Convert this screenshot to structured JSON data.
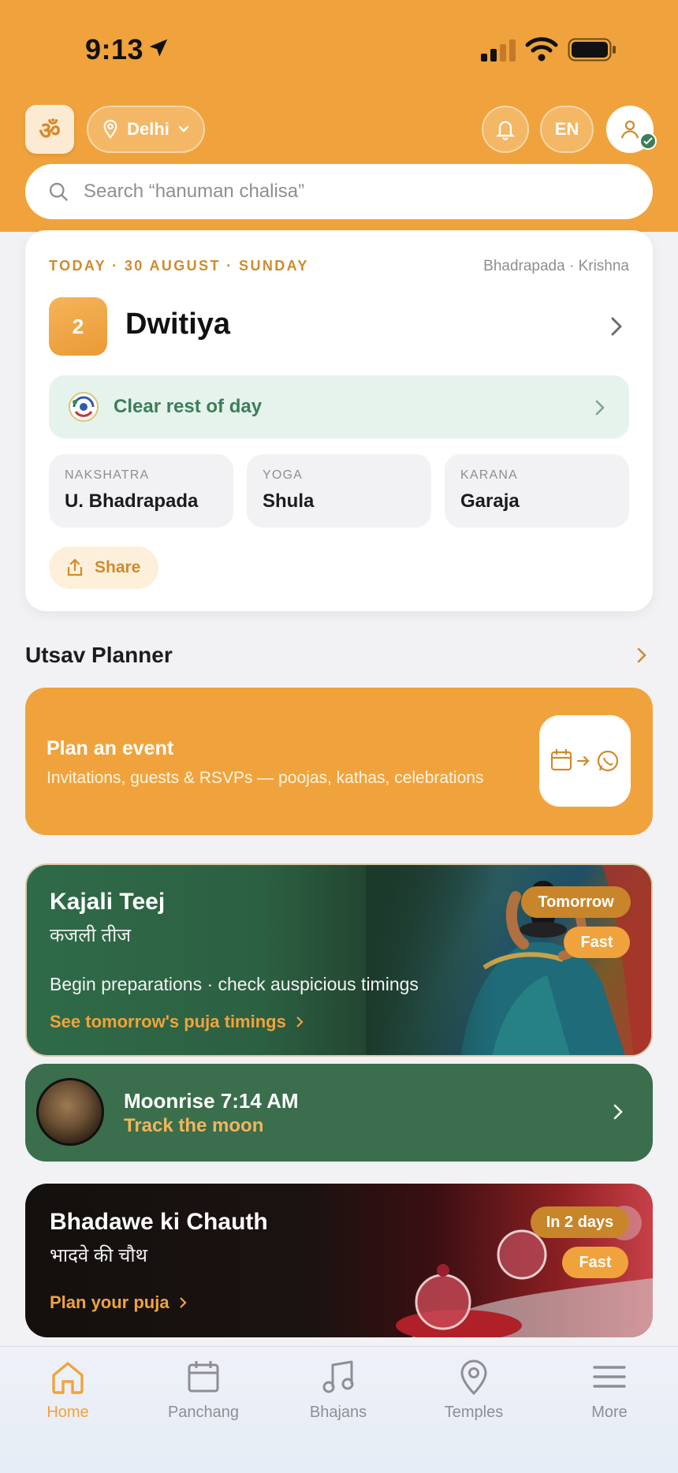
{
  "status_bar": {
    "time": "9:13"
  },
  "header": {
    "logo": "ॐ",
    "location": "Delhi",
    "language": "EN",
    "search_placeholder": "Search “hanuman chalisa”"
  },
  "today": {
    "date_line": "TODAY · 30 AUGUST · SUNDAY",
    "month_paksha": "Bhadrapada · Krishna",
    "tithi_number": "2",
    "tithi_name": "Dwitiya",
    "status": "Clear rest of day",
    "details": [
      {
        "label": "NAKSHATRA",
        "value": "U. Bhadrapada"
      },
      {
        "label": "YOGA",
        "value": "Shula"
      },
      {
        "label": "KARANA",
        "value": "Garaja"
      }
    ],
    "share_label": "Share"
  },
  "utsav": {
    "title": "Utsav Planner",
    "plan_title": "Plan an event",
    "plan_subtitle": "Invitations, guests & RSVPs — poojas, kathas, celebrations"
  },
  "festivals": [
    {
      "name": "Kajali Teej",
      "hindi": "कजली तीज",
      "desc": "Begin preparations · check auspicious timings",
      "link": "See tomorrow's puja timings",
      "when": "Tomorrow",
      "tag": "Fast"
    },
    {
      "name": "Bhadawe ki Chauth",
      "hindi": "भादवे की चौथ",
      "link": "Plan your puja",
      "when": "In 2 days",
      "tag": "Fast"
    }
  ],
  "moon": {
    "title": "Moonrise 7:14 AM",
    "subtitle": "Track the moon"
  },
  "tabs": [
    {
      "label": "Home",
      "icon": "home-icon"
    },
    {
      "label": "Panchang",
      "icon": "calendar-icon"
    },
    {
      "label": "Bhajans",
      "icon": "music-note-icon"
    },
    {
      "label": "Temples",
      "icon": "map-pin-icon"
    },
    {
      "label": "More",
      "icon": "menu-icon"
    }
  ],
  "colors": {
    "accent": "#F0A33C",
    "green": "#3B6E4C",
    "status_green": "#3B7E5A"
  }
}
